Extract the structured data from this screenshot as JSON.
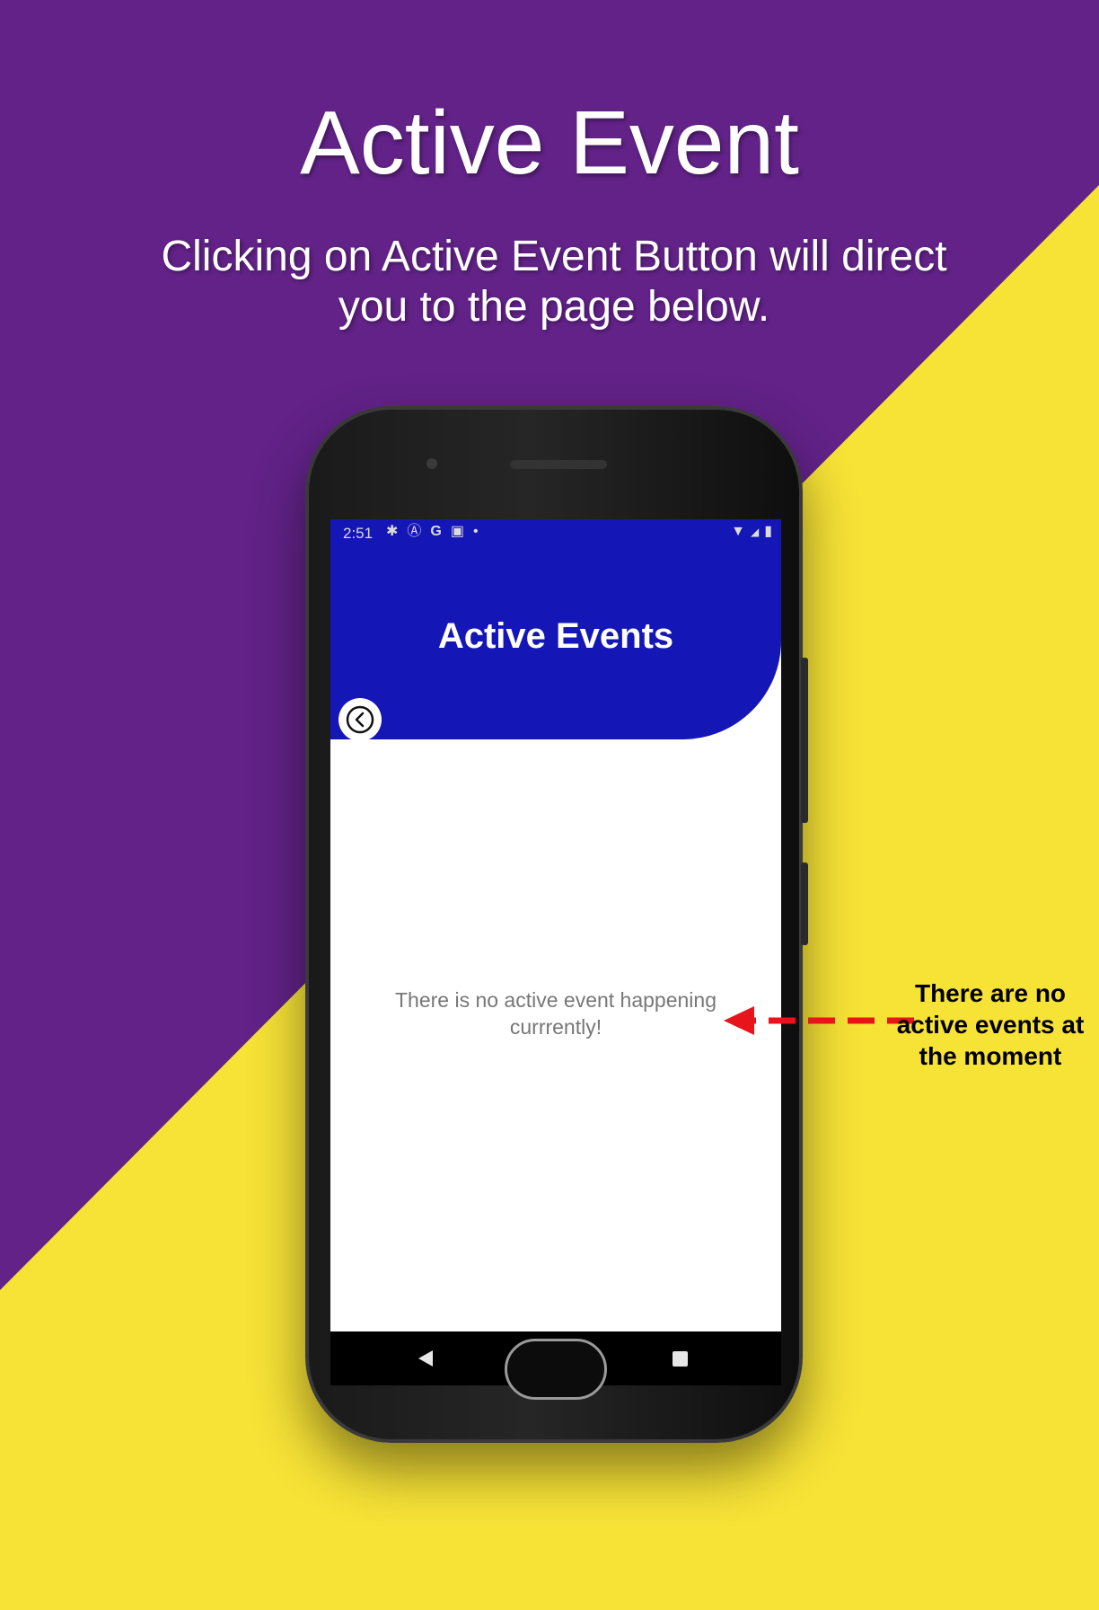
{
  "banner": {
    "headline": "Active Event",
    "description": "Clicking on Active Event Button will direct you to the page below.",
    "colors": {
      "purple": "#622288",
      "yellow": "#f7e236"
    }
  },
  "device": {
    "status_bar": {
      "time": "2:51",
      "left_icons": [
        "settings-icon",
        "a-circle-icon",
        "google-icon",
        "image-icon",
        "dot-icon"
      ],
      "right_icons": [
        "wifi-icon",
        "signal-icon",
        "battery-icon"
      ],
      "left_glyphs": [
        "✱",
        "Ⓐ",
        "G",
        "▣",
        "•"
      ],
      "right_glyphs": [
        "▼",
        "◢",
        "▮"
      ]
    },
    "app": {
      "title": "Active Events",
      "back_icon": "chevron-left-circle-icon",
      "empty_message": "There is no active event happening currrently!",
      "colors": {
        "appbar": "#1416b5",
        "message": "#777777"
      }
    },
    "nav_bar": {
      "back_icon": "nav-back-triangle-icon",
      "home_icon": "nav-home-circle-icon",
      "recents_icon": "nav-recents-square-icon"
    }
  },
  "callout": {
    "text": "There are no active events at the moment",
    "arrow_color": "#e8141c"
  }
}
